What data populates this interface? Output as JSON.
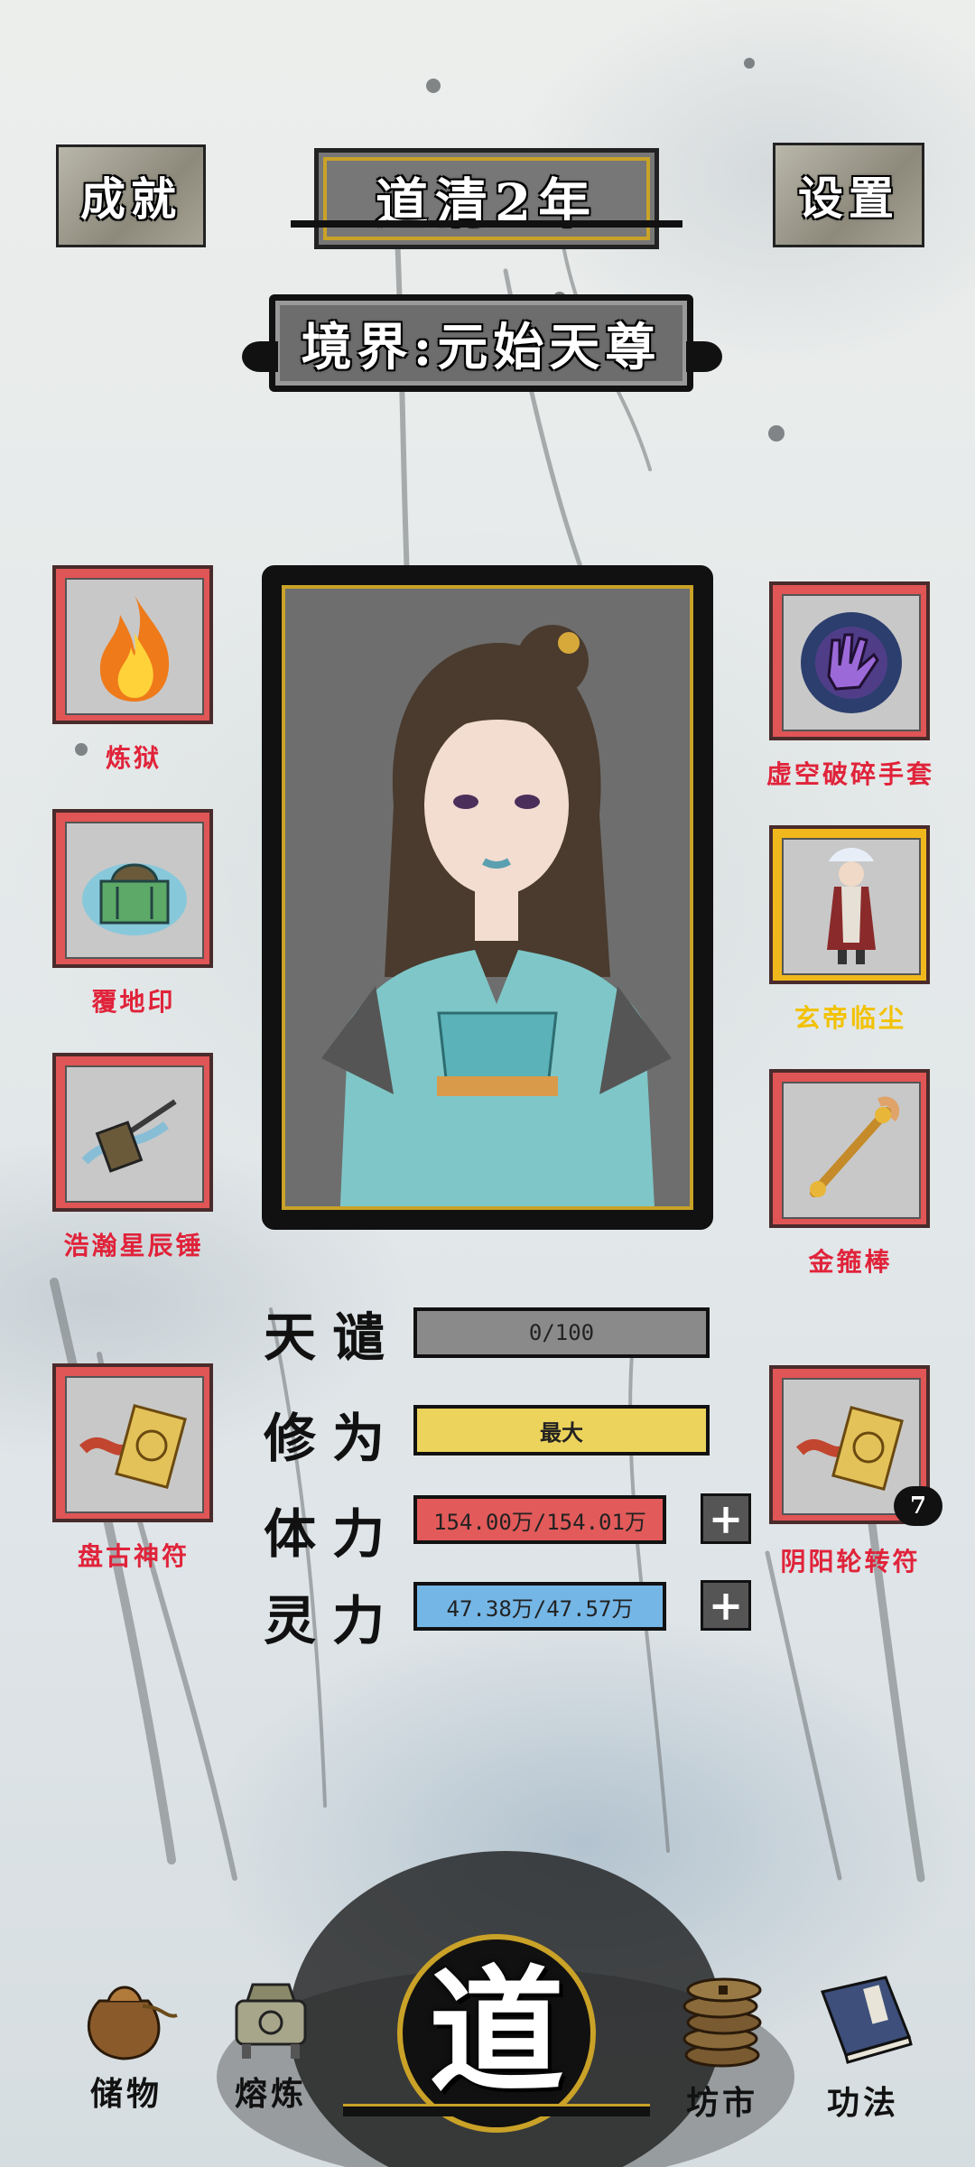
{
  "header": {
    "achievements_label": "成就",
    "year_label": "道清2年",
    "settings_label": "设置"
  },
  "realm": {
    "label": "境界:元始天尊"
  },
  "equipment": {
    "left": [
      {
        "label": "炼狱",
        "icon": "fire-icon"
      },
      {
        "label": "覆地印",
        "icon": "seal-icon"
      },
      {
        "label": "浩瀚星辰锤",
        "icon": "hammer-icon"
      },
      {
        "label": "盘古神符",
        "icon": "talisman-icon"
      }
    ],
    "right": [
      {
        "label": "虚空破碎手套",
        "icon": "gauntlet-icon"
      },
      {
        "label": "玄帝临尘",
        "icon": "figure-icon"
      },
      {
        "label": "金箍棒",
        "icon": "staff-icon"
      },
      {
        "label": "阴阳轮转符",
        "icon": "talisman-icon",
        "badge": "7"
      }
    ]
  },
  "stats": {
    "tribulation": {
      "label": "天谴",
      "value": "0/100",
      "progress": 0
    },
    "cultivation": {
      "label": "修为",
      "value": "最大",
      "progress": 1
    },
    "stamina": {
      "label": "体力",
      "value": "154.00万/154.01万",
      "progress": 0.9999
    },
    "spirit": {
      "label": "灵力",
      "value": "47.38万/47.57万",
      "progress": 0.996
    }
  },
  "nav": {
    "storage": "储物",
    "smelting": "熔炼",
    "dao": "道",
    "market": "坊市",
    "techniques": "功法"
  },
  "colors": {
    "slot_red": "#e05555",
    "slot_gold": "#f0b81c",
    "label_red": "#e0233a",
    "cultivation_bar": "#ecd35b",
    "stamina_bar": "#e25a5a",
    "spirit_bar": "#74b6e6",
    "tribulation_bar": "#8a8a8a"
  }
}
